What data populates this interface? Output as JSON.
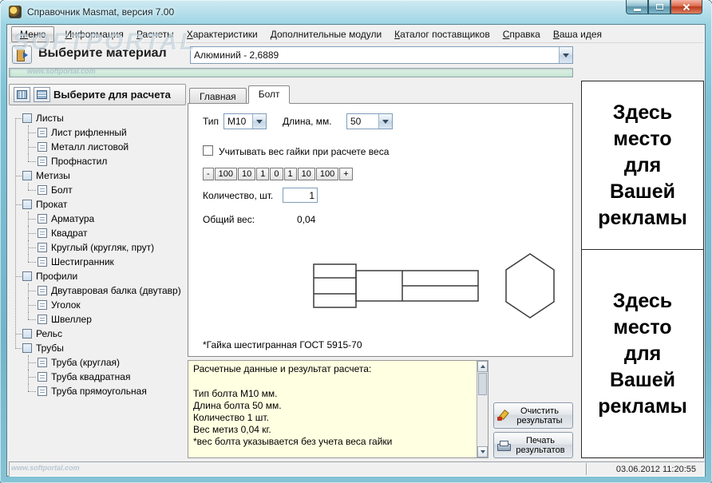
{
  "window": {
    "title": "Справочник Masmat, версия 7.00"
  },
  "watermark": {
    "logo": "SOFTPORTAL",
    "url": "www.softportal.com"
  },
  "menu": {
    "items": [
      "Меню",
      "Информация",
      "Расчеты",
      "Характеристики",
      "Дополнительные модули",
      "Каталог поставщиков",
      "Справка",
      "Ваша идея"
    ]
  },
  "material": {
    "label": "Выберите материал",
    "value": "Алюминий - 2,6889"
  },
  "sidebar": {
    "header": "Выберите для расчета",
    "tree": [
      {
        "label": "Листы",
        "children": [
          "Лист рифленный",
          "Металл листовой",
          "Профнастил"
        ]
      },
      {
        "label": "Метизы",
        "children": [
          "Болт"
        ]
      },
      {
        "label": "Прокат",
        "children": [
          "Арматура",
          "Квадрат",
          "Круглый (кругляк, прут)",
          "Шестигранник"
        ]
      },
      {
        "label": "Профили",
        "children": [
          "Двутавровая балка (двутавр)",
          "Уголок",
          "Швеллер"
        ]
      },
      {
        "label": "Рельс",
        "children": []
      },
      {
        "label": "Трубы",
        "children": [
          "Труба (круглая)",
          "Труба квадратная",
          "Труба прямоугольная"
        ]
      }
    ]
  },
  "tabs": [
    {
      "label": "Главная"
    },
    {
      "label": "Болт"
    }
  ],
  "form": {
    "type_label": "Тип",
    "type_value": "M10",
    "length_label": "Длина, мм.",
    "length_value": "50",
    "nut_checkbox": "Учитывать вес гайки при расчете веса",
    "stepper": [
      "-",
      "100",
      "10",
      "1",
      "0",
      "1",
      "10",
      "100",
      "+"
    ],
    "quantity_label": "Количество, шт.",
    "quantity_value": "1",
    "total_label": "Общий вес:",
    "total_value": "0,04",
    "footnote": "*Гайка шестигранная ГОСТ 5915-70"
  },
  "results": {
    "title": "Расчетные данные и результат расчета:",
    "lines": [
      "Тип болта M10 мм.",
      "Длина болта 50 мм.",
      "Количество 1 шт.",
      "Вес метиз 0,04 кг.",
      " *вес болта указывается без учета веса гайки"
    ],
    "clear_button": "Очистить результаты",
    "print_button": "Печать результатов"
  },
  "ads": {
    "lines": [
      "Здесь",
      "место",
      "для",
      "Вашей",
      "рекламы"
    ]
  },
  "statusbar": {
    "datetime": "03.06.2012 11:20:55"
  }
}
